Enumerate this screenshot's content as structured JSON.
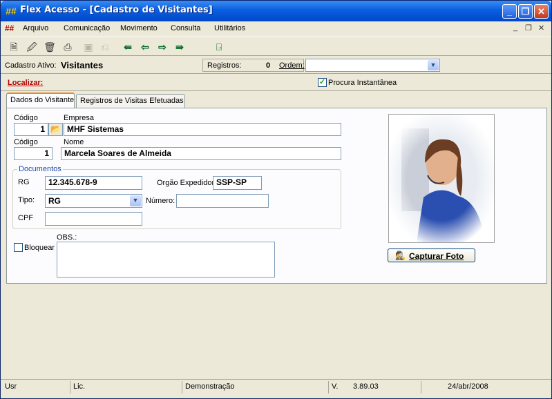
{
  "window": {
    "title": "Flex Acesso - [Cadastro de Visitantes]",
    "logo_glyph": "##",
    "minimize_glyph": "_",
    "restore_glyph": "❐",
    "close_glyph": "✕"
  },
  "menu": {
    "items": [
      "Arquivo",
      "Comunicação",
      "Movimento",
      "Consulta",
      "Utilitários"
    ],
    "mdi_minimize": "_",
    "mdi_restore": "❐",
    "mdi_close": "✕"
  },
  "toolbar": {
    "icons": [
      "new-record-icon",
      "edit-record-icon",
      "delete-record-icon",
      "print-icon",
      "save-icon",
      "cancel-icon",
      "first-record-icon",
      "previous-record-icon",
      "next-record-icon",
      "last-record-icon",
      "exit-icon"
    ]
  },
  "infobar": {
    "cadastro_label": "Cadastro Ativo:",
    "cadastro_value": "Visitantes",
    "registros_label": "Registros:",
    "registros_value": "0",
    "ordem_label": "Ordem:",
    "ordem_value": ""
  },
  "search": {
    "localizar_label": "Localizar:",
    "procura_label": "Procura Instantânea",
    "procura_checked": true
  },
  "tabs": [
    {
      "label": "Dados do Visitante",
      "active": true
    },
    {
      "label": "Registros de Visitas Efetuadas",
      "active": false
    }
  ],
  "form": {
    "codigo_empresa_label": "Código",
    "empresa_label": "Empresa",
    "codigo_empresa": "1",
    "empresa": "MHF Sistemas",
    "codigo_label": "Código",
    "nome_label": "Nome",
    "codigo": "1",
    "nome": "Marcela Soares de Almeida",
    "documentos_title": "Documentos",
    "rg_label": "RG",
    "rg": "12.345.678-9",
    "orgao_label": "Orgão Expedidor",
    "orgao": "SSP-SP",
    "tipo_label": "Tipo:",
    "tipo": "RG",
    "numero_label": "Número:",
    "numero": "",
    "cpf_label": "CPF",
    "cpf": "",
    "bloquear_label": "Bloquear",
    "bloquear_checked": false,
    "obs_label": "OBS.:",
    "obs": ""
  },
  "photo": {
    "capture_label": "Capturar Foto"
  },
  "status": {
    "user": "Usr",
    "lic": "Lic.",
    "mode": "Demonstração",
    "version_label": "V.",
    "version": "3.89.03",
    "date": "24/abr/2008"
  }
}
